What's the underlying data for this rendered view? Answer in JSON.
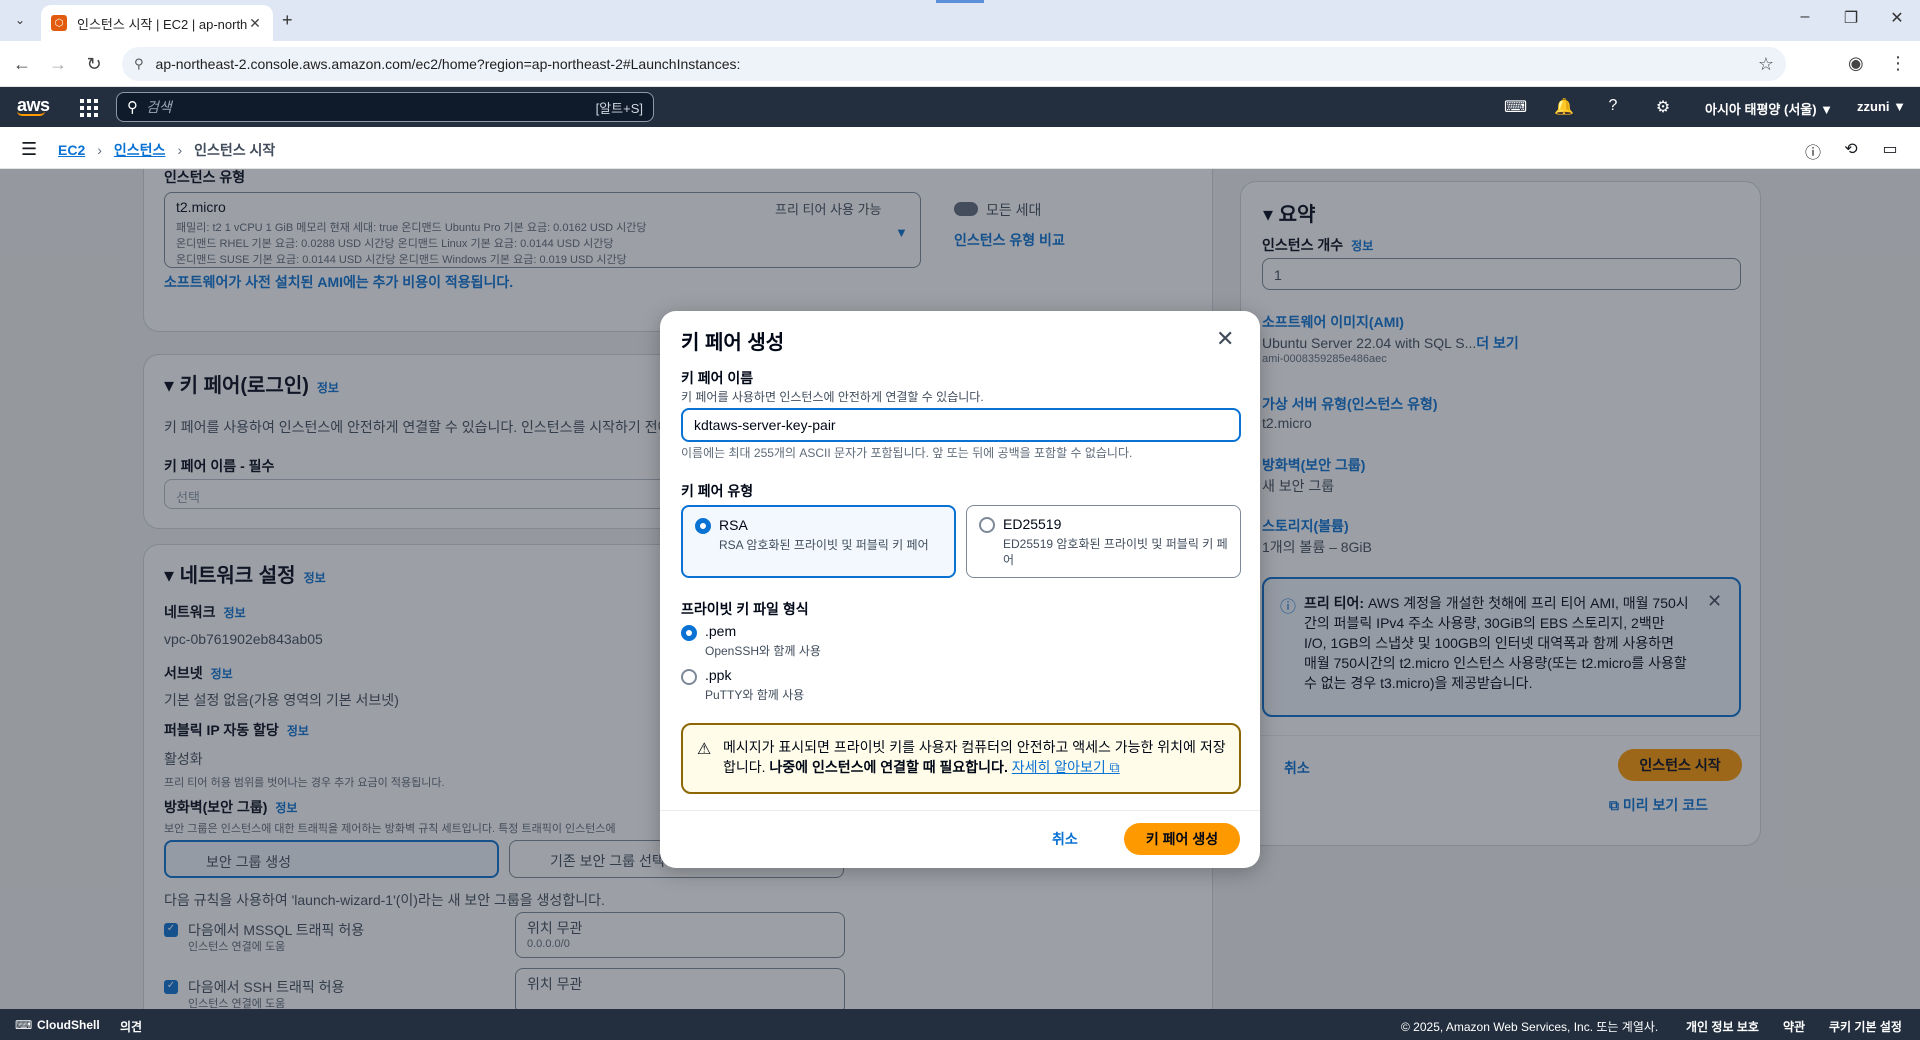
{
  "browser": {
    "tab_title": "인스턴스 시작 | EC2 | ap-north",
    "url": "ap-northeast-2.console.aws.amazon.com/ec2/home?region=ap-northeast-2#LaunchInstances:"
  },
  "header": {
    "search_placeholder": "검색",
    "search_shortcut": "[알트+S]",
    "region": "아시아 태평양 (서울) ▼",
    "user": "zzuni ▼"
  },
  "breadcrumb": {
    "items": [
      "EC2",
      "인스턴스"
    ],
    "current": "인스턴스 시작"
  },
  "background": {
    "instance_type_label": "인스턴스 유형",
    "instance_type_value": "t2.micro",
    "instance_type_line1": "패밀리: t2    1 vCPU    1 GiB 메모리    현재 세대: true        온디맨드 Ubuntu Pro 기본 요금: 0.0162 USD 시간당",
    "instance_type_line2": "온디맨드 RHEL 기본 요금: 0.0288 USD 시간당    온디맨드 Linux 기본 요금: 0.0144 USD 시간당",
    "instance_type_line3": "온디맨드 SUSE 기본 요금: 0.0144 USD 시간당    온디맨드 Windows 기본 요금: 0.019 USD 시간당",
    "free_tier_badge": "프리 티어 사용 가능",
    "all_generations": "모든 세대",
    "compare_types": "인스턴스 유형 비교",
    "ami_cost_note": "소프트웨어가 사전 설치된 AMI에는 추가 비용이 적용됩니다.",
    "key_pair_section": "키 페어(로그인)",
    "info": "정보",
    "key_pair_desc": "키 페어를 사용하여 인스턴스에 안전하게 연결할 수 있습니다. 인스턴스를 시작하기 전에",
    "key_pair_name_label": "키 페어 이름 - 필수",
    "key_pair_select": "선택",
    "network_section": "네트워크 설정",
    "network_label": "네트워크",
    "network_value": "vpc-0b761902eb843ab05",
    "subnet_label": "서브넷",
    "subnet_value": "기본 설정 없음(가용 영역의 기본 서브넷)",
    "public_ip_label": "퍼블릭 IP 자동 할당",
    "public_ip_value": "활성화",
    "public_ip_note": "프리 티어 허용 범위를 벗어나는 경우 추가 요금이 적용됩니다.",
    "firewall_label": "방화벽(보안 그룹)",
    "firewall_desc": "보안 그룹은 인스턴스에 대한 트래픽을 제어하는 방화벽 규칙 세트입니다. 특정 트래픽이 인스턴스에",
    "create_sg": "보안 그룹 생성",
    "existing_sg": "기존 보안 그룹 선택",
    "rules_note": "다음 규칙을 사용하여 'launch-wizard-1'(이)라는 새 보안 그룹을 생성합니다.",
    "mssql_rule": "다음에서 MSSQL 트래픽 허용",
    "mssql_sub": "인스턴스 연결에 도움",
    "ssh_rule": "다음에서 SSH 트래픽 허용",
    "ssh_sub": "인스턴스 연결에 도움",
    "anywhere": "위치 무관",
    "anywhere_cidr": "0.0.0.0/0"
  },
  "summary": {
    "title": "요약",
    "count_label": "인스턴스 개수",
    "count_value": "1",
    "ami_label": "소프트웨어 이미지(AMI)",
    "ami_value": "Ubuntu Server 22.04 with SQL S...",
    "ami_more": "더 보기",
    "ami_id": "ami-0008359285e486aec",
    "vs_label": "가상 서버 유형(인스턴스 유형)",
    "vs_value": "t2.micro",
    "fw_label": "방화벽(보안 그룹)",
    "fw_value": "새 보안 그룹",
    "storage_label": "스토리지(볼륨)",
    "storage_value": "1개의 볼륨 – 8GiB",
    "free_tier_title": "프리 티어:",
    "free_tier_text": " AWS 계정을 개설한 첫해에 프리 티어 AMI, 매월 750시간의 퍼블릭 IPv4 주소 사용량, 30GiB의 EBS 스토리지, 2백만 I/O, 1GB의 스냅샷 및 100GB의 인터넷 대역폭과 함께 사용하면 매월 750시간의 t2.micro 인스턴스 사용량(또는 t2.micro를 사용할 수 없는 경우 t3.micro)을 제공받습니다.",
    "cancel": "취소",
    "launch": "인스턴스 시작",
    "preview_code": "미리 보기 코드"
  },
  "modal": {
    "title": "키 페어 생성",
    "name_label": "키 페어 이름",
    "name_desc": "키 페어를 사용하면 인스턴스에 안전하게 연결할 수 있습니다.",
    "name_value": "kdtaws-server-key-pair",
    "name_hint": "이름에는 최대 255개의 ASCII 문자가 포함됩니다. 앞 또는 뒤에 공백을 포함할 수 없습니다.",
    "type_label": "키 페어 유형",
    "types": [
      {
        "title": "RSA",
        "desc": "RSA 암호화된 프라이빗 및 퍼블릭 키 페어"
      },
      {
        "title": "ED25519",
        "desc": "ED25519 암호화된 프라이빗 및 퍼블릭 키 페어"
      }
    ],
    "format_label": "프라이빗 키 파일 형식",
    "formats": [
      {
        "title": ".pem",
        "desc": "OpenSSH와 함께 사용"
      },
      {
        "title": ".ppk",
        "desc": "PuTTY와 함께 사용"
      }
    ],
    "warning_text": "메시지가 표시되면 프라이빗 키를 사용자 컴퓨터의 안전하고 액세스 가능한 위치에 저장합니다. ",
    "warning_bold": "나중에 인스턴스에 연결할 때 필요합니다.",
    "warning_link": "자세히 알아보기",
    "cancel": "취소",
    "create": "키 페어 생성"
  },
  "footer": {
    "cloudshell": "CloudShell",
    "feedback": "의견",
    "copyright": "© 2025, Amazon Web Services, Inc. 또는 계열사.",
    "privacy": "개인 정보 보호",
    "terms": "약관",
    "cookies": "쿠키 기본 설정"
  }
}
